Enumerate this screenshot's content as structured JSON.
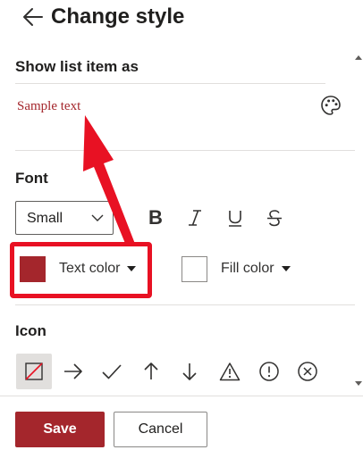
{
  "header": {
    "title": "Change style",
    "back_icon": "arrow-left-icon"
  },
  "list_item": {
    "label": "Show list item as",
    "sample_text": "Sample text",
    "sample_color": "#a4262c",
    "palette_icon": "palette-icon"
  },
  "font": {
    "label": "Font",
    "size_value": "Small",
    "bold_glyph": "B",
    "text_color": {
      "label": "Text color",
      "swatch": "#a4262c"
    },
    "fill_color": {
      "label": "Fill color",
      "swatch": "#ffffff"
    }
  },
  "icon_section": {
    "label": "Icon",
    "icons": [
      "none-icon",
      "arrow-right-icon",
      "checkmark-icon",
      "arrow-up-icon",
      "arrow-down-icon",
      "warning-icon",
      "important-icon",
      "error-circle-icon"
    ],
    "selected": "none-icon"
  },
  "footer": {
    "save_label": "Save",
    "cancel_label": "Cancel"
  },
  "colors": {
    "accent": "#a4262c",
    "annotation": "#e81123"
  }
}
